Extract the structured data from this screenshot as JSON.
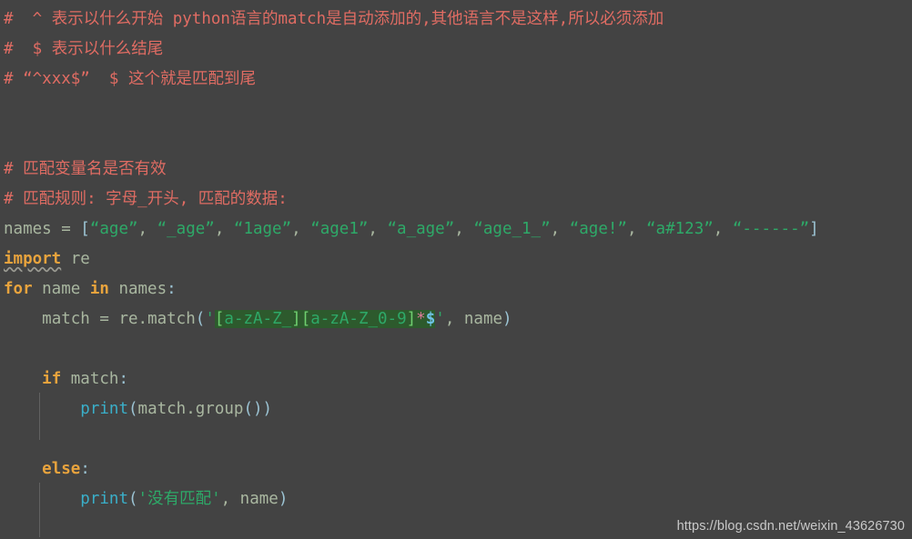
{
  "editor": {
    "background_color": "#434343",
    "font_size_px": 17.5,
    "line_height_px": 33,
    "language": "python"
  },
  "colors": {
    "background": "#434343",
    "comment": "#e06c63",
    "keyword": "#e8a33d",
    "identifier": "#a9b7a0",
    "string": "#2ea968",
    "function": "#3aafc9",
    "punctuation": "#9cc4d4",
    "regex_highlight_background": "#2d5a2d",
    "regex_bracket": "#6fcf6f",
    "regex_quantifier": "#e07a9a",
    "regex_anchor": "#6fc4e8",
    "indent_guide": "#6b6b6b",
    "watermark": "#c9c9c9"
  },
  "code": {
    "line1": {
      "hash": "#",
      "text": "  ^ 表示以什么开始 python语言的match是自动添加的,其他语言不是这样,所以必须添加"
    },
    "line2": {
      "hash": "#",
      "text": "  $ 表示以什么结尾"
    },
    "line3": {
      "hash": "#",
      "text": " “^xxx$”  $ 这个就是匹配到尾"
    },
    "line6": {
      "hash": "#",
      "text": " 匹配变量名是否有效"
    },
    "line7": {
      "hash": "#",
      "text": " 匹配规则: 字母_开头, 匹配的数据:"
    },
    "line8": {
      "var": "names",
      "equals": " = ",
      "open_bracket": "[",
      "items": [
        "“age”",
        "“_age”",
        "“1age”",
        "“age1”",
        "“a_age”",
        "“age_1_”",
        "“age!”",
        "“a#123”",
        "“------”"
      ],
      "separator": ", ",
      "close_bracket": "]"
    },
    "line9": {
      "keyword": "import",
      "module": " re"
    },
    "line10": {
      "for_kw": "for",
      "loop_var": " name ",
      "in_kw": "in",
      "iterable": " names",
      "colon": ":"
    },
    "line11": {
      "indent": "    ",
      "var": "match",
      "equals": " = ",
      "module": "re",
      "dot": ".",
      "method": "match",
      "open_paren": "(",
      "quote_open": "'",
      "regex_b1_open": "[",
      "regex_b1_body": "a-zA-Z_",
      "regex_b1_close": "]",
      "regex_b2_open": "[",
      "regex_b2_body": "a-zA-Z_0-9",
      "regex_b2_close": "]",
      "regex_star": "*",
      "regex_anchor": "$",
      "quote_close": "'",
      "comma_arg": ", name",
      "close_paren": ")"
    },
    "line13": {
      "indent": "    ",
      "keyword": "if",
      "var": " match",
      "colon": ":"
    },
    "line14": {
      "indent": "        ",
      "fn": "print",
      "open_paren": "(",
      "arg": "match",
      "dot": ".",
      "method": "group",
      "inner_parens": "()",
      "close_paren": ")"
    },
    "line16": {
      "indent": "    ",
      "keyword": "else",
      "colon": ":"
    },
    "line17": {
      "indent": "        ",
      "fn": "print",
      "open_paren": "(",
      "string": "'没有匹配'",
      "comma_arg": ", name",
      "close_paren": ")"
    }
  },
  "watermark": {
    "url": "https://blog.csdn.net/weixin_43626730"
  }
}
